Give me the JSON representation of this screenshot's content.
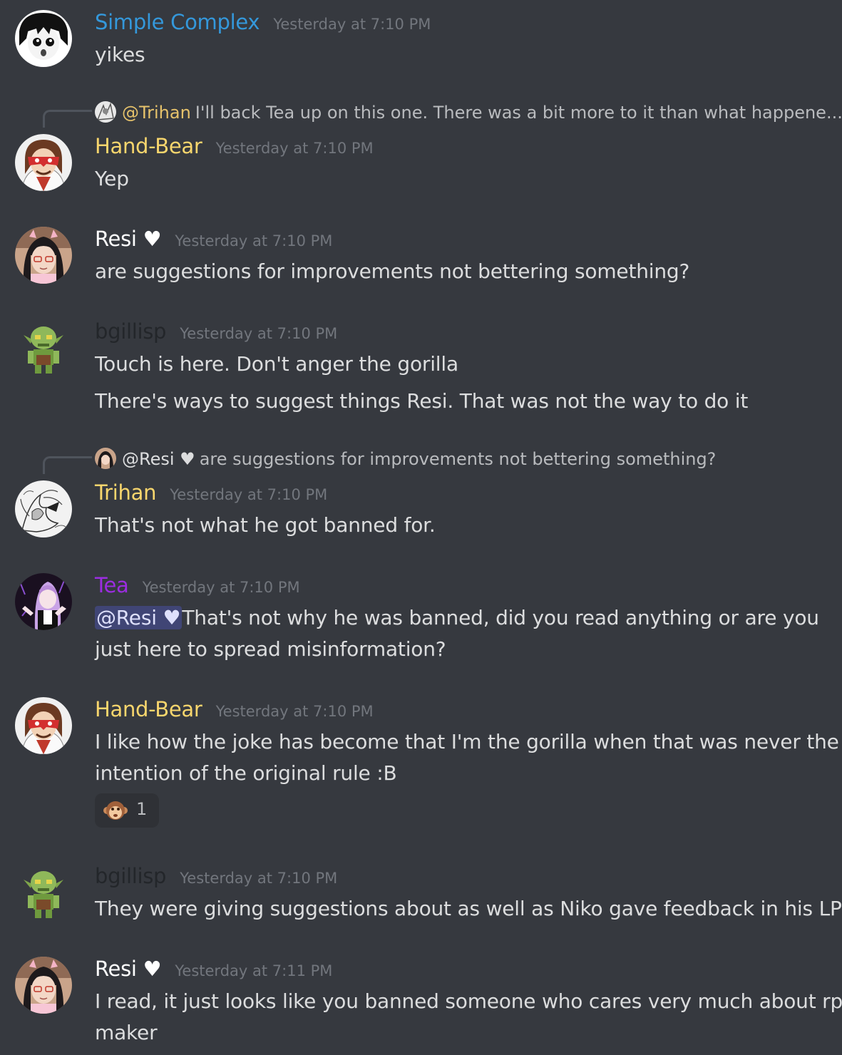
{
  "messages": [
    {
      "author": "Simple Complex",
      "author_color": "#3498db",
      "timestamp": "Yesterday at 7:10 PM",
      "lines": [
        "yikes"
      ]
    },
    {
      "reply_to": {
        "author": "@Trihan",
        "author_color": "#e6c26b",
        "text": "I'll back Tea up on this one. There was a bit more to it than what happene..."
      },
      "author": "Hand-Bear",
      "author_color": "#f8d66d",
      "timestamp": "Yesterday at 7:10 PM",
      "lines": [
        "Yep"
      ]
    },
    {
      "author": "Resi ♥",
      "author_color": "#ffffff",
      "timestamp": "Yesterday at 7:10 PM",
      "lines": [
        "are suggestions for improvements not bettering something?"
      ]
    },
    {
      "author": "bgillisp",
      "author_color": "#23262a",
      "timestamp": "Yesterday at 7:10 PM",
      "lines": [
        "Touch is here. Don't anger the gorilla",
        "There's ways to suggest things Resi. That was not the way to do it"
      ]
    },
    {
      "reply_to": {
        "author": "@Resi ♥",
        "author_color": "#dcddde",
        "text": "are suggestions for improvements not bettering something?"
      },
      "author": "Trihan",
      "author_color": "#f8d66d",
      "timestamp": "Yesterday at 7:10 PM",
      "lines": [
        "That's not what he got banned for."
      ]
    },
    {
      "author": "Tea",
      "author_color": "#9b2de0",
      "timestamp": "Yesterday at 7:10 PM",
      "mention": "@Resi ♥",
      "lines": [
        "That's not why he was banned, did you read anything or are you",
        "just here to spread misinformation?"
      ]
    },
    {
      "author": "Hand-Bear",
      "author_color": "#f8d66d",
      "timestamp": "Yesterday at 7:10 PM",
      "lines": [
        "I like how the joke has become that I'm the gorilla when that was never the",
        "intention of the original rule :B"
      ],
      "reaction": {
        "emoji": "monkey-face",
        "count": "1"
      }
    },
    {
      "author": "bgillisp",
      "author_color": "#23262a",
      "timestamp": "Yesterday at 7:10 PM",
      "lines": [
        "They were giving suggestions about as well as Niko gave feedback in his LP's."
      ]
    },
    {
      "author": "Resi ♥",
      "author_color": "#ffffff",
      "timestamp": "Yesterday at 7:11 PM",
      "lines": [
        "I read, it just looks like you banned someone who cares very much about rpg",
        "maker"
      ]
    }
  ]
}
